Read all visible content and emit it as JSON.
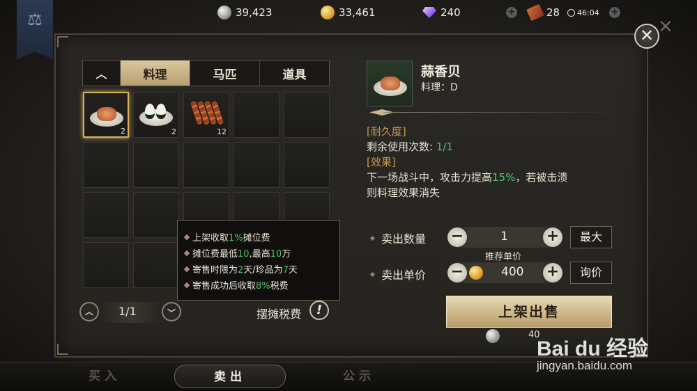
{
  "topbar": {
    "silver": "39,423",
    "gold": "33,461",
    "gems": "240",
    "tickets": "28",
    "timer": "46:04"
  },
  "tabs": [
    {
      "label": "料理",
      "active": true
    },
    {
      "label": "马匹",
      "active": false
    },
    {
      "label": "道具",
      "active": false
    }
  ],
  "inventory": {
    "items": [
      {
        "name": "蒜香贝",
        "count": "2",
        "icon": "garlic-scallop-icon"
      },
      {
        "name": "饭团",
        "count": "2",
        "icon": "rice-ball-icon"
      },
      {
        "name": "烤串",
        "count": "12",
        "icon": "skewer-icon"
      }
    ],
    "page": "1/1"
  },
  "tax": {
    "label": "摆摊税费",
    "tips": [
      [
        "上架收取",
        "1%",
        "摊位费"
      ],
      [
        "摊位费最低",
        "10",
        ",最高",
        "10",
        "万"
      ],
      [
        "寄售时限为",
        "2",
        "天/珍品为",
        "7",
        "天"
      ],
      [
        "寄售成功后收取",
        "8%",
        "税费"
      ]
    ]
  },
  "item": {
    "name": "蒜香贝",
    "type": "料理：D",
    "durability_header": "[耐久度]",
    "uses_label": "剩余使用次数: ",
    "uses_value": "1/1",
    "effect_header": "[效果]",
    "effect_pre": "下一场战斗中，攻击力提高",
    "effect_pct": "15%",
    "effect_post": "，若被击溃",
    "effect_line2": "则料理效果消失"
  },
  "sell": {
    "qty_label": "卖出数量",
    "qty_value": "1",
    "max_label": "最大",
    "rec_price_label": "推荐单价",
    "price_label": "卖出单价",
    "price_value": "400",
    "inquire_label": "询价",
    "submit_label": "上架出售",
    "fee_value": "40"
  },
  "bottom_nav": [
    {
      "label": "买入",
      "active": false
    },
    {
      "label": "卖出",
      "active": true
    },
    {
      "label": "公示",
      "active": false
    }
  ],
  "watermark": {
    "logo": "Bai du 经验",
    "url": "jingyan.baidu.com"
  }
}
